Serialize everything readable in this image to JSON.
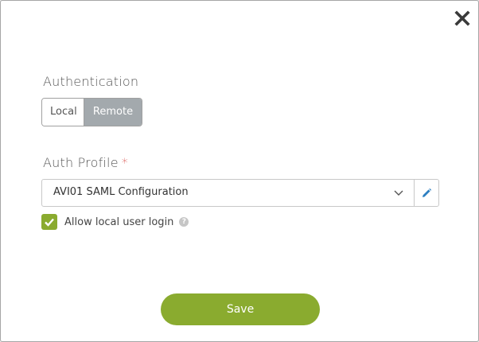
{
  "dialog": {
    "close_icon": "close-icon"
  },
  "authentication": {
    "label": "Authentication",
    "options": [
      "Local",
      "Remote"
    ],
    "selected": "Remote"
  },
  "auth_profile": {
    "label": "Auth Profile",
    "required_marker": "*",
    "value": "AVI01 SAML Configuration",
    "dropdown_icon": "chevron-down-icon",
    "edit_icon": "pencil-icon"
  },
  "allow_local_login": {
    "label": "Allow local user login",
    "checked": true,
    "help_icon": "question-circle-icon",
    "help_glyph": "?"
  },
  "actions": {
    "save_label": "Save"
  },
  "colors": {
    "accent": "#8aab2f",
    "toggle_selected_bg": "#a3a9ad",
    "required": "#d9534f"
  }
}
